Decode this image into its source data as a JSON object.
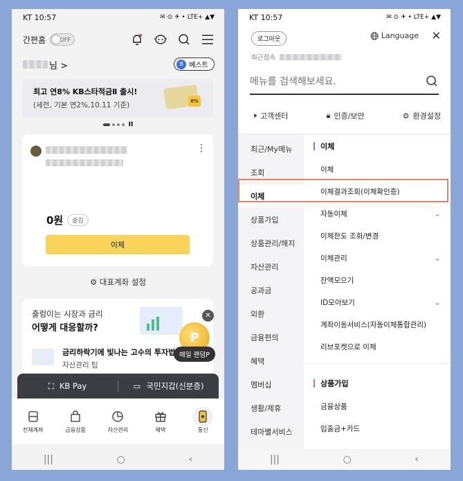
{
  "left": {
    "status": {
      "time": "KT 10:57",
      "icons": "✉ ⊙ ✈ •",
      "right": "LTE+ ▲▼"
    },
    "topbar": {
      "simple_home_label": "간편홈",
      "toggle_label": "OFF"
    },
    "user": {
      "name_suffix": "님 >",
      "best_badge_icon": "B",
      "best_badge_label": "베스트"
    },
    "banner": {
      "line1": "최고 연8% KB스타적금Ⅱ 출시!",
      "line2": "(세전, 기본 연2%,10.11 기준)",
      "percent": "8%"
    },
    "pager_pause": "II",
    "account": {
      "balance": "0원",
      "hide_label": "숨김",
      "transfer_button": "이체"
    },
    "rep_account_setting": "대표계좌 설정",
    "promo": {
      "line1": "출렁이는 시장과 금리",
      "line2": "어떻게 대응할까?",
      "line3": "금리하락기에 빛나는 고수의 투자법",
      "line4": "자산관리 팁",
      "coin": "P",
      "close": "✕",
      "daily_label": "매일 랜덤P"
    },
    "quickbar": {
      "kbpay": "KB Pay",
      "wallet": "국민지갑(신분증)"
    },
    "tabs": [
      {
        "label": "전체계좌"
      },
      {
        "label": "금융상품"
      },
      {
        "label": "자산관리"
      },
      {
        "label": "혜택"
      },
      {
        "label": "통신"
      }
    ]
  },
  "right": {
    "status": {
      "time": "KT 10:57",
      "icons": "✉ ⊙ ✈ •",
      "right": "LTE+ ▲▼"
    },
    "logout_label": "로그아웃",
    "language_label": "Language",
    "close_label": "✕",
    "recent_label": "최근접속",
    "search_placeholder": "메뉴를 검색해보세요.",
    "quicklinks": {
      "customer": "고객센터",
      "security": "인증/보안",
      "settings": "환경설정"
    },
    "categories": [
      "최근/My메뉴",
      "조회",
      "이체",
      "상품가입",
      "상품관리/해지",
      "자산관리",
      "공과금",
      "외환",
      "금융편의",
      "혜택",
      "멤버십",
      "생활/제휴",
      "테마별서비스"
    ],
    "selected_category": "이체",
    "section_transfer": {
      "title": "이체",
      "items": [
        {
          "label": "이체",
          "chevron": ""
        },
        {
          "label": "이체결과조회(이체확인증)",
          "chevron": ""
        },
        {
          "label": "자동이체",
          "chevron": "⌄"
        },
        {
          "label": "이체한도 조회/변경",
          "chevron": ""
        },
        {
          "label": "이체관리",
          "chevron": "⌄"
        },
        {
          "label": "잔액모으기",
          "chevron": ""
        },
        {
          "label": "ID모아보기",
          "chevron": "⌄"
        },
        {
          "label": "계좌이동서비스(자동이체통합관리)",
          "chevron": ""
        },
        {
          "label": "리브포켓으로 이체",
          "chevron": ""
        }
      ]
    },
    "section_products": {
      "title": "상품가입",
      "items": [
        {
          "label": "금융상품"
        },
        {
          "label": "입출금+카드"
        }
      ]
    }
  },
  "nav": {
    "recent": "|||",
    "home": "○",
    "back": "‹"
  }
}
